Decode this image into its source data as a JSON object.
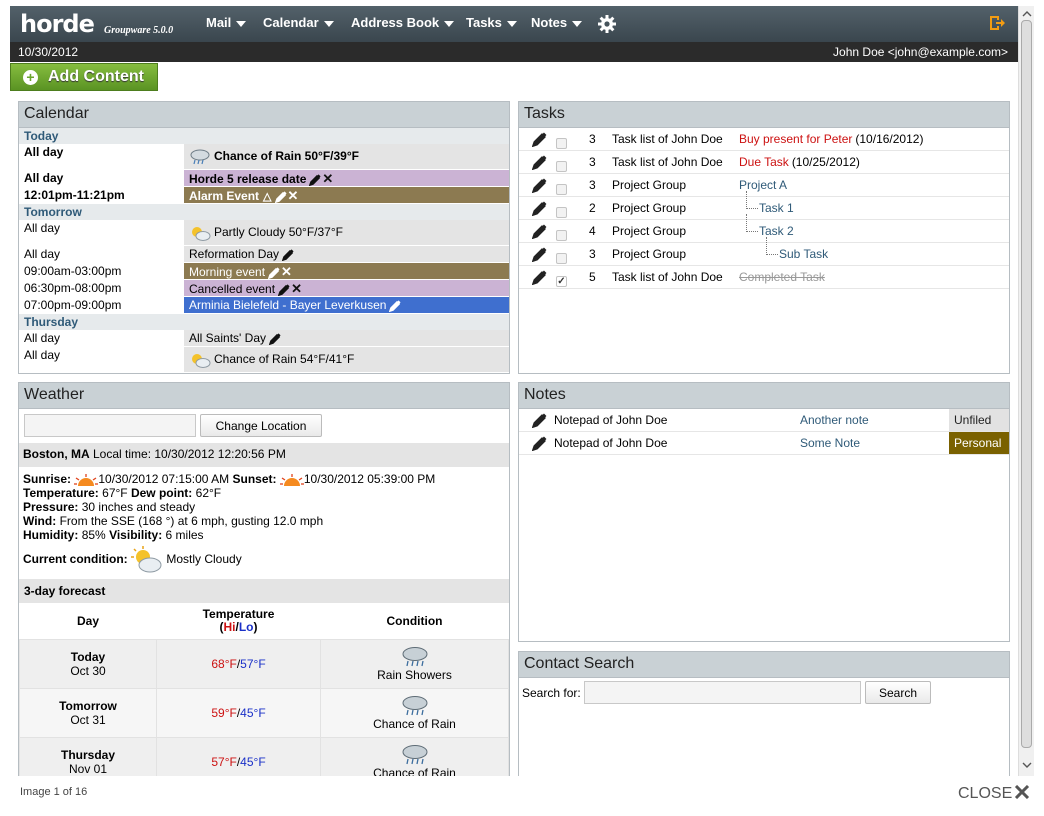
{
  "header": {
    "logo": "horde",
    "logo_sub": "Groupware 5.0.0",
    "menus": [
      "Mail",
      "Calendar",
      "Address Book",
      "Tasks",
      "Notes"
    ],
    "gear_icon": "gear-icon",
    "logout_icon": "logout-icon"
  },
  "datebar": {
    "date": "10/30/2012",
    "user": "John Doe <john@example.com>"
  },
  "add_content": "Add Content",
  "calendar": {
    "title": "Calendar",
    "sections": [
      {
        "label": "Today",
        "rows": [
          {
            "time": "All day",
            "event": "Chance of Rain 50°F/39°F",
            "color": "#e4e4e4",
            "bold": true,
            "icon": "rain-cloud-icon"
          },
          {
            "time": "All day",
            "event": "Horde 5 release date",
            "color": "#cbb3d4",
            "bold": true,
            "edit": true,
            "delete": true
          },
          {
            "time": "12:01pm-11:21pm",
            "event": "Alarm Event",
            "color": "#8c7a51",
            "bold": true,
            "alarm": true,
            "edit": true,
            "delete": true
          }
        ]
      },
      {
        "label": "Tomorrow",
        "rows": [
          {
            "time": "All day",
            "event": "Partly Cloudy 50°F/37°F",
            "color": "#e4e4e4",
            "icon": "sun-cloud-icon"
          },
          {
            "time": "All day",
            "event": "Reformation Day",
            "color": "#e4e4e4",
            "edit": true
          },
          {
            "time": "09:00am-03:00pm",
            "event": "Morning event",
            "color": "#8c7a51",
            "edit": true,
            "delete": true
          },
          {
            "time": "06:30pm-08:00pm",
            "event": "Cancelled event",
            "color": "#cbb3d4",
            "edit": true,
            "delete": true
          },
          {
            "time": "07:00pm-09:00pm",
            "event": "Arminia Bielefeld - Bayer Leverkusen",
            "color": "#3f6fcf",
            "edit": true
          }
        ]
      },
      {
        "label": "Thursday",
        "rows": [
          {
            "time": "All day",
            "event": "All Saints' Day",
            "color": "#e4e4e4",
            "edit": true
          },
          {
            "time": "All day",
            "event": "Chance of Rain 54°F/41°F",
            "color": "#e4e4e4",
            "icon": "sun-cloud-icon"
          }
        ]
      }
    ]
  },
  "tasks": {
    "title": "Tasks",
    "rows": [
      {
        "priority": "3",
        "list": "Task list of John Doe",
        "name": "Buy present for Peter",
        "due": "(10/16/2012)",
        "overdue": true,
        "indent": 0,
        "done": false
      },
      {
        "priority": "3",
        "list": "Task list of John Doe",
        "name": "Due Task",
        "due": "(10/25/2012)",
        "overdue": true,
        "indent": 0,
        "done": false
      },
      {
        "priority": "3",
        "list": "Project Group",
        "name": "Project A",
        "due": "",
        "overdue": false,
        "indent": 0,
        "done": false
      },
      {
        "priority": "2",
        "list": "Project Group",
        "name": "Task 1",
        "due": "",
        "overdue": false,
        "indent": 1,
        "done": false
      },
      {
        "priority": "4",
        "list": "Project Group",
        "name": "Task 2",
        "due": "",
        "overdue": false,
        "indent": 1,
        "done": false
      },
      {
        "priority": "3",
        "list": "Project Group",
        "name": "Sub Task",
        "due": "",
        "overdue": false,
        "indent": 2,
        "done": false
      },
      {
        "priority": "5",
        "list": "Task list of John Doe",
        "name": "Completed Task",
        "due": "",
        "overdue": false,
        "indent": 0,
        "done": true
      }
    ]
  },
  "weather": {
    "title": "Weather",
    "location_input": "",
    "change_location": "Change Location",
    "location": "Boston, MA",
    "local_time_label": "Local time:",
    "local_time": "10/30/2012 12:20:56 PM",
    "sunrise_label": "Sunrise:",
    "sunrise": "10/30/2012 07:15:00 AM",
    "sunset_label": "Sunset:",
    "sunset": "10/30/2012 05:39:00 PM",
    "temperature_label": "Temperature:",
    "temperature": "67°F",
    "dewpoint_label": "Dew point:",
    "dewpoint": "62°F",
    "pressure_label": "Pressure:",
    "pressure": "30 inches and steady",
    "wind_label": "Wind:",
    "wind": "From the SSE (168 °) at 6 mph, gusting 12.0 mph",
    "humidity_label": "Humidity:",
    "humidity": "85%",
    "visibility_label": "Visibility:",
    "visibility": "6 miles",
    "condition_label": "Current condition:",
    "condition": "Mostly Cloudy",
    "forecast_title": "3-day forecast",
    "col_day": "Day",
    "col_temp": "Temperature",
    "col_hi": "Hi",
    "col_slash": "/",
    "col_lo": "Lo",
    "col_paren_open": "(",
    "col_paren_close": ")",
    "col_condition": "Condition",
    "forecast": [
      {
        "day": "Today",
        "date": "Oct 30",
        "hi": "68°F",
        "lo": "57°F",
        "cond": "Rain Showers"
      },
      {
        "day": "Tomorrow",
        "date": "Oct 31",
        "hi": "59°F",
        "lo": "45°F",
        "cond": "Chance of Rain"
      },
      {
        "day": "Thursday",
        "date": "Nov 01",
        "hi": "57°F",
        "lo": "45°F",
        "cond": "Chance of Rain"
      }
    ]
  },
  "notes": {
    "title": "Notes",
    "rows": [
      {
        "notepad": "Notepad of John Doe",
        "name": "Another note",
        "category": "Unfiled",
        "cat_color": "#e2e2e2",
        "cat_text": "#222222"
      },
      {
        "notepad": "Notepad of John Doe",
        "name": "Some Note",
        "category": "Personal",
        "cat_color": "#7a6100",
        "cat_text": "#ffffff"
      }
    ]
  },
  "contact_search": {
    "title": "Contact Search",
    "label": "Search for:",
    "value": "",
    "button": "Search"
  },
  "footer": {
    "image_count": "Image 1 of 16",
    "close": "CLOSE"
  },
  "colors": {
    "overdue": "#cc1111",
    "link": "#2f5a78"
  }
}
